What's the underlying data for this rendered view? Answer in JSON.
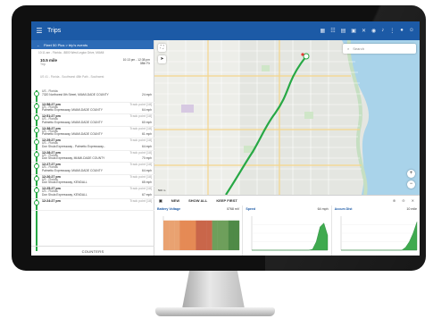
{
  "app": {
    "title": "Trips"
  },
  "left_panel": {
    "breadcrumb": "Fleet 50 Plus > trip's events",
    "note": "10:11 am - Florida - 8800 West Legion Drive, MIAMI",
    "first": {
      "duration": "10.5 mile",
      "sub": "Trip",
      "time_range": "10:13 pm - 12:38 pm",
      "extra": "08th Flr"
    },
    "subnote": "US 41 - Florida - Southwest 48th Path - Southwest",
    "entries": [
      {
        "time": "",
        "kind": "",
        "addr": "US - Florida",
        "road": "7320 Northwest 8th Street, MIAMI-DADE COUNTY",
        "speed": "24 mph"
      },
      {
        "time": "12:58:27 pm",
        "kind": "Track point [18]",
        "addr": "US - Florida",
        "road": "Palmetto Expressway, MIAMI-DADE COUNTY",
        "speed": "64 mph"
      },
      {
        "time": "12:51:27 pm",
        "kind": "Track point [18]",
        "addr": "US - Florida",
        "road": "Palmetto Expressway, MIAMI-DADE COUNTY",
        "speed": "60 mph"
      },
      {
        "time": "12:38:27 pm",
        "kind": "Track point [18]",
        "addr": "US - Florida",
        "road": "Palmetto Expressway, MIAMI-DADE COUNTY",
        "speed": "61 mph"
      },
      {
        "time": "12:29:27 pm",
        "kind": "Track point [18]",
        "addr": "US - Florida",
        "road": "Don Shula Expressway - Palmetto Expressway...",
        "speed": "64 mph"
      },
      {
        "time": "12:28:27 pm",
        "kind": "Track point [18]",
        "addr": "US - Florida",
        "road": "Don Shula Expressway, MIAMI-DADE COUNTY",
        "speed": "70 mph"
      },
      {
        "time": "12:27:27 pm",
        "kind": "Track point [18]",
        "addr": "US - Florida",
        "road": "Palmetto Expressway, MIAMI-DADE COUNTY",
        "speed": "64 mph"
      },
      {
        "time": "12:26:27 pm",
        "kind": "Track point [18]",
        "addr": "US - Florida",
        "road": "Don Shula Expressway, KENDALL",
        "speed": "65 mph"
      },
      {
        "time": "12:25:27 pm",
        "kind": "Track point [18]",
        "addr": "US - Florida",
        "road": "Don Shula Expressway, KENDALL",
        "speed": "67 mph"
      },
      {
        "time": "12:24:27 pm",
        "kind": "Track point [18]",
        "addr": "",
        "road": "",
        "speed": ""
      }
    ],
    "counters_label": "COUNTERS"
  },
  "map": {
    "search_placeholder": "Search",
    "scale": "500 m"
  },
  "bottom": {
    "toolbar": {
      "new_label": "NEW",
      "show_all_label": "SHOW ALL",
      "keep_first_label": "KEEP FIRST"
    },
    "charts": [
      {
        "label": "Battery Voltage",
        "value": "0768 mV",
        "kind": "bars"
      },
      {
        "label": "Speed",
        "value": "64 mph",
        "kind": "area"
      },
      {
        "label": "Accum Dist",
        "value": "10 mile",
        "kind": "area"
      }
    ]
  },
  "chart_data": [
    {
      "type": "bar",
      "title": "Battery Voltage",
      "values": [
        28,
        28,
        28,
        28,
        28,
        28,
        28,
        28,
        28,
        28,
        28,
        28,
        28,
        28
      ],
      "ylim": [
        0,
        32
      ]
    },
    {
      "type": "area",
      "title": "Speed",
      "values": [
        0,
        0,
        0,
        0,
        0,
        0,
        0,
        0,
        0,
        0,
        0,
        0,
        0,
        0,
        0,
        0,
        2,
        20,
        55,
        64,
        35
      ],
      "ylim": [
        0,
        80
      ]
    },
    {
      "type": "area",
      "title": "Accum Dist",
      "values": [
        0,
        0,
        0,
        0,
        0,
        0,
        0,
        0,
        0,
        0,
        0,
        0,
        0,
        0,
        0,
        0,
        0,
        1,
        3,
        6,
        10
      ],
      "ylim": [
        0,
        12
      ]
    }
  ],
  "colors": {
    "brand": "#1c5aa6",
    "route": "#27a845"
  }
}
